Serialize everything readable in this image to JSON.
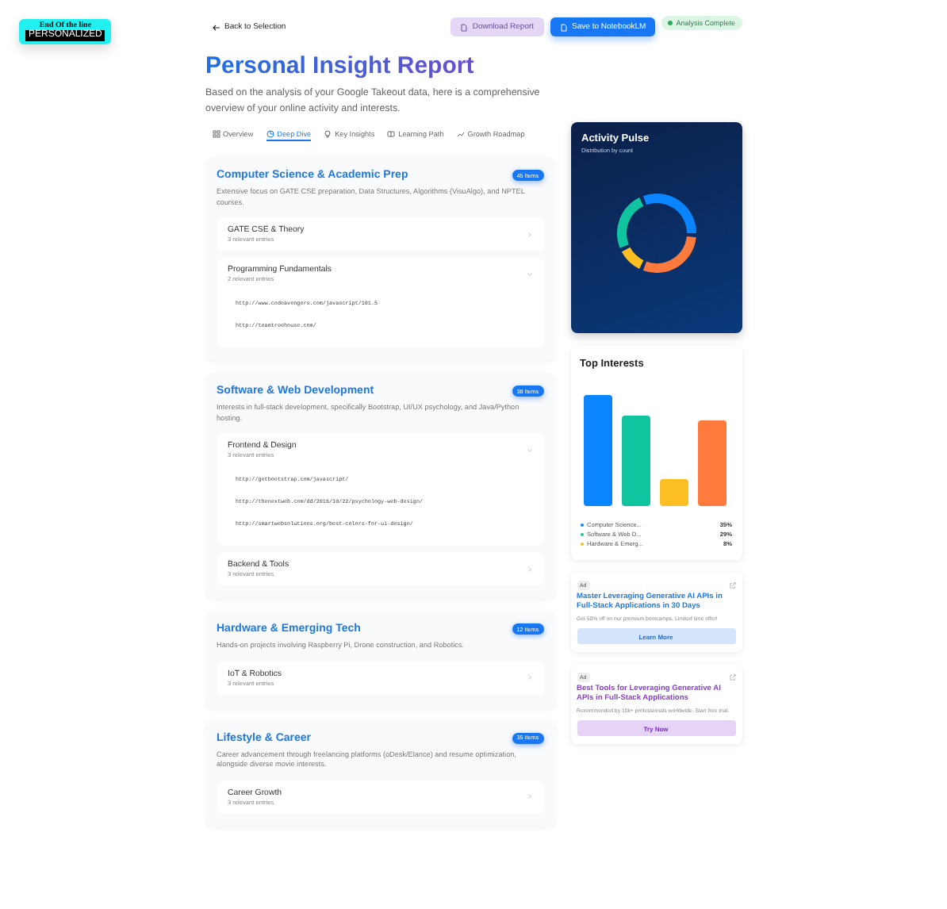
{
  "logo": {
    "line_1": "End Of the line",
    "line_2": "PERSONALIZED"
  },
  "header": {
    "back": "Back to Selection",
    "buttons": [
      {
        "label": "Download Report",
        "kind": "soft"
      },
      {
        "label": "Save to NotebookLM",
        "kind": "primary"
      }
    ],
    "status": "Analysis Complete"
  },
  "title": "Personal Insight Report",
  "description": "Based on the analysis of your Google Takeout data, here is a comprehensive overview of your online activity and interests.",
  "tabs": [
    {
      "label": "Overview",
      "kind": "grid",
      "selected": false
    },
    {
      "label": "Deep Dive",
      "kind": "pie",
      "selected": true
    },
    {
      "label": "Key Insights",
      "kind": "bulb",
      "selected": false
    },
    {
      "label": "Learning Path",
      "kind": "book",
      "selected": false
    },
    {
      "label": "Growth Roadmap",
      "kind": "trend",
      "selected": false
    }
  ],
  "categories": [
    {
      "title": "Computer Science & Academic Prep",
      "count": "45 Items",
      "description": "Extensive focus on GATE CSE preparation, Data Structures, Algorithms (VisuAlgo), and NPTEL courses.",
      "groups": [
        {
          "name": "GATE CSE & Theory",
          "entries": "3 relevant entries",
          "expanded": false
        },
        {
          "name": "Programming Fundamentals",
          "entries": "2 relevant entries",
          "expanded": true,
          "links": [
            "http://www.codeavengers.com/javascript/101.5",
            "http://teamtreehouse.com/"
          ]
        }
      ]
    },
    {
      "title": "Software & Web Development",
      "count": "38 Items",
      "description": "Interests in full-stack development, specifically Bootstrap, UI/UX psychology, and Java/Python hosting.",
      "groups": [
        {
          "name": "Frontend & Design",
          "entries": "3 relevant entries",
          "expanded": true,
          "links": [
            "http://getbootstrap.com/javascript/",
            "http://thenextweb.com/dd/2016/10/22/psychology-web-design/",
            "http://smartwebsolutions.org/best-colors-for-ui-design/"
          ]
        },
        {
          "name": "Backend & Tools",
          "entries": "3 relevant entries",
          "expanded": false
        }
      ]
    },
    {
      "title": "Hardware & Emerging Tech",
      "count": "12 Items",
      "description": "Hands-on projects involving Raspberry Pi, Drone construction, and Robotics.",
      "groups": [
        {
          "name": "IoT & Robotics",
          "entries": "3 relevant entries",
          "expanded": false
        }
      ]
    },
    {
      "title": "Lifestyle & Career",
      "count": "35 Items",
      "description": "Career advancement through freelancing platforms (oDesk/Elance) and resume optimization, alongside diverse movie interests.",
      "groups": [
        {
          "name": "Career Growth",
          "entries": "3 relevant entries",
          "expanded": false
        }
      ]
    }
  ],
  "activity_pulse": {
    "title": "Activity Pulse",
    "subtitle": "Distribution by count"
  },
  "top_interests": {
    "title": "Top Interests",
    "legend": [
      {
        "label": "Computer Science...",
        "value": "35%",
        "color": "#0a84ff"
      },
      {
        "label": "Software & Web D...",
        "value": "29%",
        "color": "#10c4a0"
      },
      {
        "label": "Hardware & Emerg...",
        "value": "8%",
        "color": "#fbbf24"
      }
    ]
  },
  "ads": [
    {
      "tag": "Ad",
      "title": "Master Leveraging Generative AI APIs in Full-Stack Applications in 30 Days",
      "text": "Get 50% off on our premium bootcamps. Limited time offer!",
      "button": "Learn More",
      "kind": "blue"
    },
    {
      "tag": "Ad",
      "title": "Best Tools for Leveraging Generative AI APIs in Full-Stack Applications",
      "text": "Recommended by 10k+ professionals worldwide. Start free trial.",
      "button": "Try Now",
      "kind": "purple"
    }
  ]
}
